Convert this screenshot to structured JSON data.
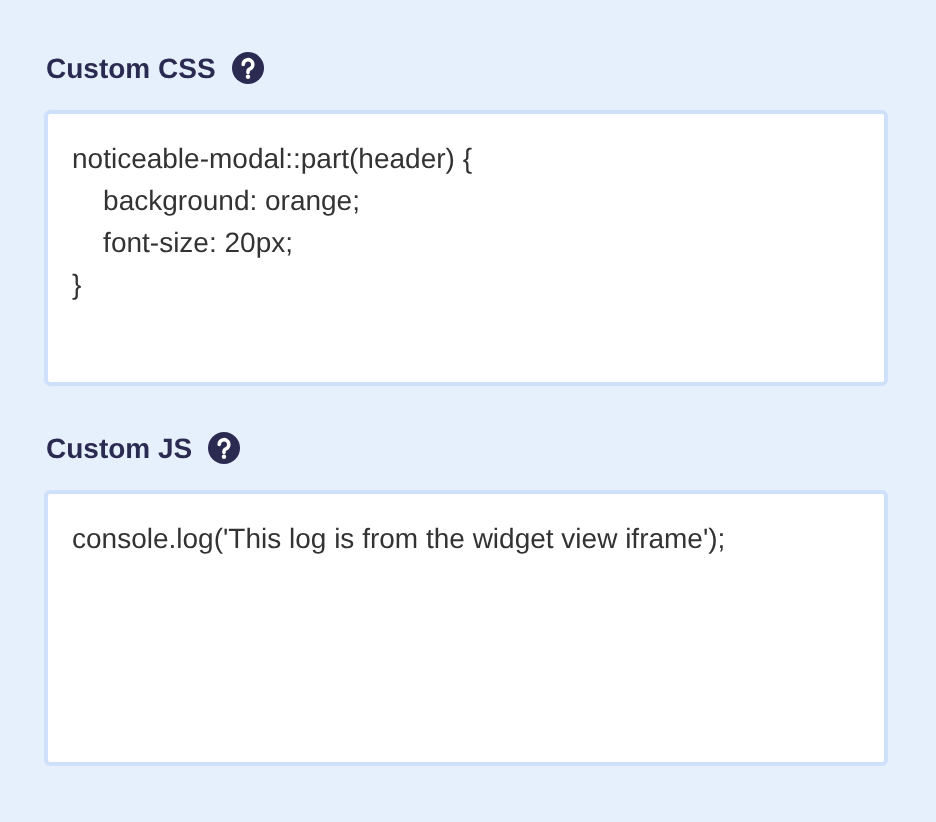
{
  "fields": [
    {
      "label": "Custom CSS",
      "lines": [
        "noticeable-modal::part(header) {",
        "    background: orange;",
        "    font-size: 20px;",
        "}"
      ]
    },
    {
      "label": "Custom JS",
      "lines": [
        "console.log('This log is from the widget view iframe');"
      ]
    }
  ]
}
